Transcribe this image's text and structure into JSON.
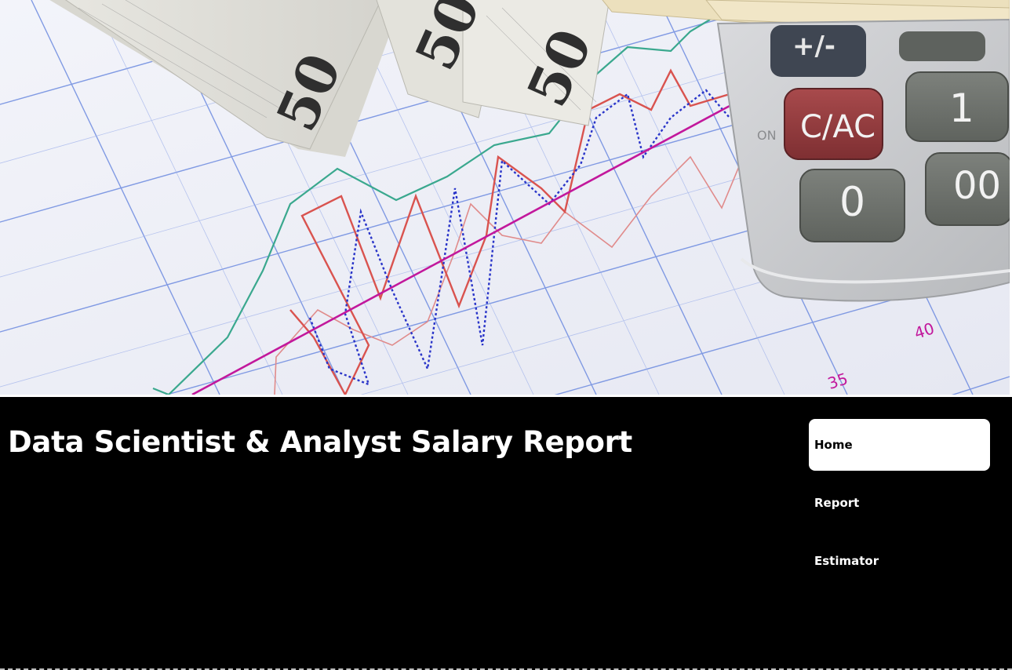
{
  "hero": {
    "image_name": "salary-chart-money-calculator-photo",
    "banknote_text": "50",
    "calculator_keys": [
      "+/-",
      "C/AC",
      "1",
      "0",
      "00",
      "ON"
    ],
    "axis_labels": [
      "35",
      "40"
    ]
  },
  "header": {
    "title": "Data Scientist & Analyst Salary Report"
  },
  "nav": {
    "items": [
      {
        "label": "Home",
        "active": true
      },
      {
        "label": "Report",
        "active": false
      },
      {
        "label": "Estimator",
        "active": false
      }
    ]
  },
  "colors": {
    "background": "#000000",
    "text": "#ffffff",
    "active_nav_bg": "#ffffff",
    "active_nav_text": "#000000",
    "grid_line": "#4a6fd8",
    "series_red": "#d9534f",
    "series_teal": "#3aa88e",
    "series_blue_dotted": "#2a35c9",
    "trend_magenta": "#c2189c"
  }
}
